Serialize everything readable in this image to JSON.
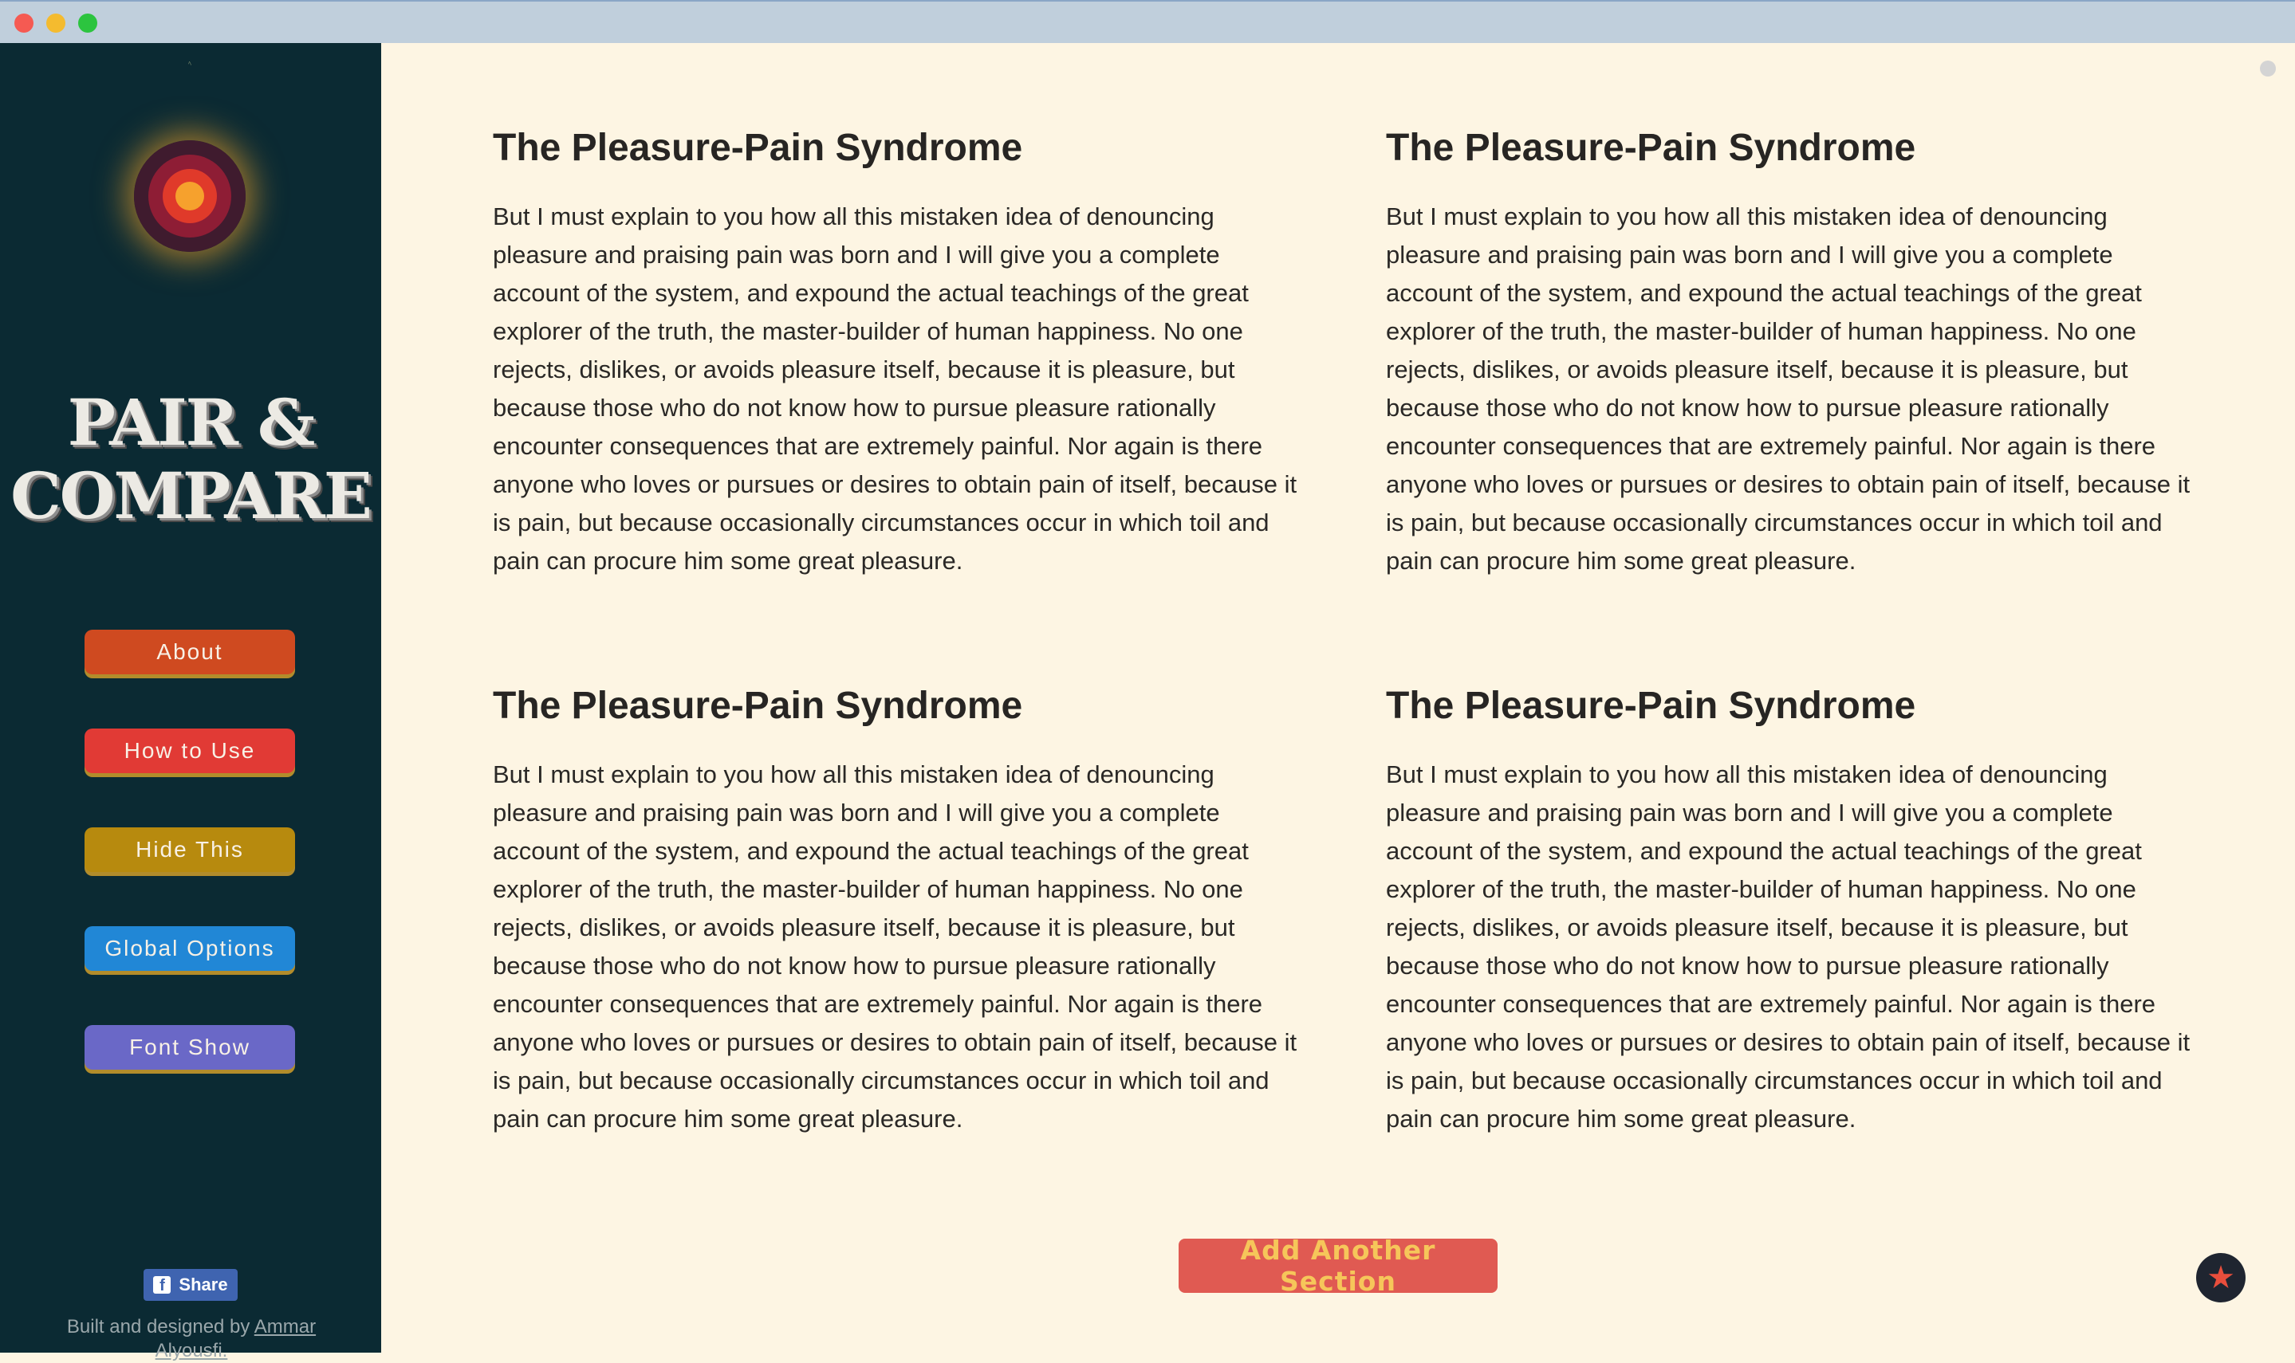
{
  "sidebar": {
    "brand_line1": "PAIR &",
    "brand_line2": "COMPARE",
    "nav": {
      "about": "About",
      "how_to_use": "How to Use",
      "hide_this": "Hide This",
      "global_options": "Global Options",
      "font_show": "Font Show"
    },
    "share_label": "Share",
    "credit_prefix": "Built and designed by",
    "credit_name": "Ammar Alyousfi."
  },
  "sections": [
    {
      "title": "The Pleasure-Pain Syndrome",
      "body": "But I must explain to you how all this mistaken idea of denouncing pleasure and praising pain was born and I will give you a complete account of the system, and expound the actual teachings of the great explorer of the truth, the master-builder of human happiness. No one rejects, dislikes, or avoids pleasure itself, because it is pleasure, but because those who do not know how to pursue pleasure rationally encounter consequences that are extremely painful. Nor again is there anyone who loves or pursues or desires to obtain pain of itself, because it is pain, but because occasionally circumstances occur in which toil and pain can procure him some great pleasure."
    },
    {
      "title": "The Pleasure-Pain Syndrome",
      "body": "But I must explain to you how all this mistaken idea of denouncing pleasure and praising pain was born and I will give you a complete account of the system, and expound the actual teachings of the great explorer of the truth, the master-builder of human happiness. No one rejects, dislikes, or avoids pleasure itself, because it is pleasure, but because those who do not know how to pursue pleasure rationally encounter consequences that are extremely painful. Nor again is there anyone who loves or pursues or desires to obtain pain of itself, because it is pain, but because occasionally circumstances occur in which toil and pain can procure him some great pleasure."
    },
    {
      "title": "The Pleasure-Pain Syndrome",
      "body": "But I must explain to you how all this mistaken idea of denouncing pleasure and praising pain was born and I will give you a complete account of the system, and expound the actual teachings of the great explorer of the truth, the master-builder of human happiness. No one rejects, dislikes, or avoids pleasure itself, because it is pleasure, but because those who do not know how to pursue pleasure rationally encounter consequences that are extremely painful. Nor again is there anyone who loves or pursues or desires to obtain pain of itself, because it is pain, but because occasionally circumstances occur in which toil and pain can procure him some great pleasure."
    },
    {
      "title": "The Pleasure-Pain Syndrome",
      "body": "But I must explain to you how all this mistaken idea of denouncing pleasure and praising pain was born and I will give you a complete account of the system, and expound the actual teachings of the great explorer of the truth, the master-builder of human happiness. No one rejects, dislikes, or avoids pleasure itself, because it is pleasure, but because those who do not know how to pursue pleasure rationally encounter consequences that are extremely painful. Nor again is there anyone who loves or pursues or desires to obtain pain of itself, because it is pain, but because occasionally circumstances occur in which toil and pain can procure him some great pleasure."
    }
  ],
  "main": {
    "add_section_label": "Add Another Section",
    "favorite_icon": "star-icon"
  },
  "colors": {
    "sidebar_bg": "#0b2a33",
    "main_bg": "#fdf5e3",
    "about": "#cf4a20",
    "how_to_use": "#e13a35",
    "hide_this": "#b78a0e",
    "global_options": "#2187d6",
    "font_show": "#6a68c7",
    "add_section": "#e05a52"
  }
}
